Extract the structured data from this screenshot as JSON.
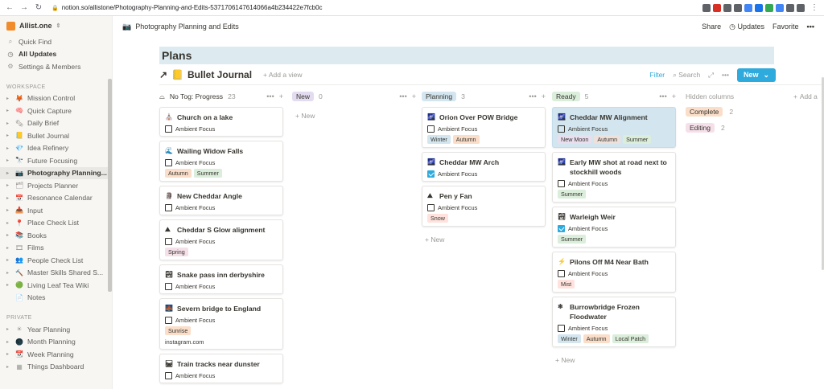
{
  "browser": {
    "url": "notion.so/allistone/Photography-Planning-and-Edits-5371706147614066a4b234422e7fcb0c",
    "ext_colors": [
      "#5f6368",
      "#d93025",
      "#5f6368",
      "#5f6368",
      "#4285f4",
      "#1a73e8",
      "#34a853",
      "#4285f4",
      "#5f6368",
      "#5f6368"
    ]
  },
  "workspace": {
    "name": "Allist.one"
  },
  "sidebar": {
    "top": [
      {
        "label": "Quick Find",
        "icon": "search-icon",
        "glyph": "⌕"
      },
      {
        "label": "All Updates",
        "icon": "clock-icon",
        "glyph": "◷",
        "bold": true
      },
      {
        "label": "Settings & Members",
        "icon": "gear-icon",
        "glyph": "⚙"
      }
    ],
    "workspace_label": "WORKSPACE",
    "workspace": [
      {
        "label": "Mission Control",
        "glyph": "🦊"
      },
      {
        "label": "Quick Capture",
        "glyph": "🧠"
      },
      {
        "label": "Daily Brief",
        "glyph": "🗞"
      },
      {
        "label": "Bullet Journal",
        "glyph": "📒"
      },
      {
        "label": "Idea Refinery",
        "glyph": "💎"
      },
      {
        "label": "Future Focusing",
        "glyph": "🔭"
      },
      {
        "label": "Photography Planning...",
        "glyph": "📷",
        "active": true
      },
      {
        "label": "Projects Planner",
        "glyph": "🗂"
      },
      {
        "label": "Resonance Calendar",
        "glyph": "📅"
      },
      {
        "label": "Input",
        "glyph": "📥"
      },
      {
        "label": "Place Check List",
        "glyph": "📍"
      },
      {
        "label": "Books",
        "glyph": "📚"
      },
      {
        "label": "Films",
        "glyph": "🎞"
      },
      {
        "label": "People Check List",
        "glyph": "👥"
      },
      {
        "label": "Master Skills Shared S...",
        "glyph": "🔨"
      },
      {
        "label": "Living Leaf Tea Wiki",
        "glyph": "🟢"
      },
      {
        "label": "Notes",
        "glyph": "📄",
        "nocaret": true
      }
    ],
    "private_label": "PRIVATE",
    "private": [
      {
        "label": "Year Planning",
        "glyph": "☀"
      },
      {
        "label": "Month Planning",
        "glyph": "🌑"
      },
      {
        "label": "Week Planning",
        "glyph": "📆"
      },
      {
        "label": "Things Dashboard",
        "glyph": "▦"
      }
    ]
  },
  "topbar": {
    "breadcrumb": "Photography Planning and Edits",
    "share": "Share",
    "updates": "Updates",
    "favorite": "Favorite",
    "more": "•••"
  },
  "page": {
    "banner": "Plans",
    "view_title": "Bullet Journal",
    "add_view": "Add a view",
    "filter": "Filter",
    "search": "Search",
    "new_label": "New"
  },
  "board": {
    "property_label": "Ambient Focus",
    "new_label": "New",
    "columns": [
      {
        "key": "noprog",
        "title": "No Tog: Progress",
        "count": "23",
        "pill": false
      },
      {
        "key": "new",
        "title": "New",
        "count": "0",
        "pill": true,
        "bg": "#e3dcf1"
      },
      {
        "key": "planning",
        "title": "Planning",
        "count": "3",
        "pill": true,
        "bg": "#d3e5ef"
      },
      {
        "key": "ready",
        "title": "Ready",
        "count": "5",
        "pill": true,
        "bg": "#dbeddb"
      }
    ],
    "cards": {
      "noprog": [
        {
          "title": "Church on a lake",
          "glyph": "⛪",
          "checked": false,
          "tags": []
        },
        {
          "title": "Wailing Widow Falls",
          "glyph": "🌊",
          "checked": false,
          "tags": [
            {
              "t": "Autumn",
              "c": "#fadec9"
            },
            {
              "t": "Summer",
              "c": "#dbeddb"
            }
          ]
        },
        {
          "title": "New Cheddar Angle",
          "glyph": "🗿",
          "checked": false,
          "tags": []
        },
        {
          "title": "Cheddar S Glow alignment",
          "glyph": "⛰",
          "checked": false,
          "tags": [
            {
              "t": "Spring",
              "c": "#f5e0e9"
            }
          ]
        },
        {
          "title": "Snake pass inn derbyshire",
          "glyph": "🏞",
          "checked": false,
          "tags": []
        },
        {
          "title": "Severn bridge to England",
          "glyph": "🌉",
          "checked": false,
          "tags": [
            {
              "t": "Sunrise",
              "c": "#fadec9"
            }
          ],
          "extra": "instagram.com"
        },
        {
          "title": "Train tracks near dunster",
          "glyph": "🛤",
          "checked": false,
          "tags": []
        }
      ],
      "planning": [
        {
          "title": "Orion Over POW Bridge",
          "glyph": "🌌",
          "checked": false,
          "tags": [
            {
              "t": "Winter",
              "c": "#d3e5ef"
            },
            {
              "t": "Autumn",
              "c": "#fadec9"
            }
          ]
        },
        {
          "title": "Cheddar MW Arch",
          "glyph": "🌌",
          "checked": true,
          "tags": []
        },
        {
          "title": "Pen y Fan",
          "glyph": "⛰",
          "checked": false,
          "tags": [
            {
              "t": "Snow",
              "c": "#ffe2dd"
            }
          ]
        }
      ],
      "ready": [
        {
          "title": "Cheddar MW Alignment",
          "glyph": "🌌",
          "checked": false,
          "hl": true,
          "tags": [
            {
              "t": "New Moon",
              "c": "#e8deee"
            },
            {
              "t": "Autumn",
              "c": "#eee0da"
            },
            {
              "t": "Summer",
              "c": "#dbeddb"
            }
          ]
        },
        {
          "title": "Early MW shot at road next to stockhill woods",
          "glyph": "🌌",
          "checked": false,
          "tags": [
            {
              "t": "Summer",
              "c": "#dbeddb"
            }
          ]
        },
        {
          "title": "Warleigh Weir",
          "glyph": "🏞",
          "checked": true,
          "tags": [
            {
              "t": "Summer",
              "c": "#dbeddb"
            }
          ]
        },
        {
          "title": "Pilons Off M4 Near Bath",
          "glyph": "⚡",
          "checked": false,
          "tags": [
            {
              "t": "Mist",
              "c": "#ffe2dd"
            }
          ]
        },
        {
          "title": "Burrowbridge Frozen Floodwater",
          "glyph": "❄",
          "checked": false,
          "tags": [
            {
              "t": "Winter",
              "c": "#d3e5ef"
            },
            {
              "t": "Autumn",
              "c": "#fadec9"
            },
            {
              "t": "Local Patch",
              "c": "#dbeddb"
            }
          ]
        }
      ]
    },
    "hidden": {
      "title": "Hidden columns",
      "items": [
        {
          "name": "Complete",
          "count": "2",
          "bg": "#fadec9"
        },
        {
          "name": "Editing",
          "count": "2",
          "bg": "#f5e0e9"
        }
      ]
    },
    "add_group": "Add a"
  }
}
